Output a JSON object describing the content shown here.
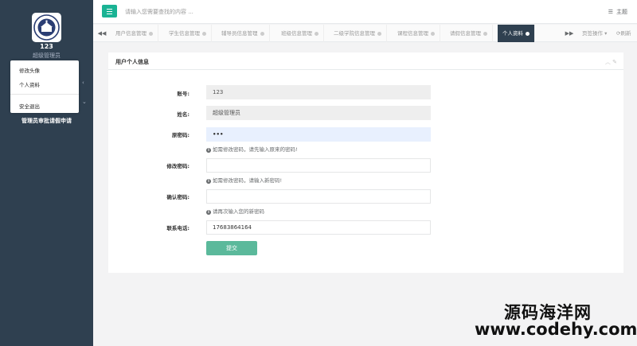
{
  "sidebar": {
    "user_name": "123",
    "user_role": "超级管理员",
    "dropdown_items": [
      "修改头像",
      "个人资料",
      "安全退出"
    ],
    "menu_item": "管理员审批请假申请"
  },
  "topbar": {
    "search_placeholder": "请输入您需要查找的内容 ...",
    "theme_label": "主题"
  },
  "tabs": {
    "items": [
      {
        "label": "用户信息管理"
      },
      {
        "label": "学生信息管理"
      },
      {
        "label": "辅导员信息管理"
      },
      {
        "label": "班级信息管理"
      },
      {
        "label": "二级学院信息管理"
      },
      {
        "label": "课程信息管理"
      },
      {
        "label": "请假信息管理"
      },
      {
        "label": "个人资料",
        "active": true
      }
    ],
    "page_ops": "页签操作",
    "refresh": "刷新"
  },
  "panel": {
    "title": "用户个人信息",
    "fields": {
      "account_label": "账号:",
      "account_value": "123",
      "name_label": "姓名:",
      "name_value": "超级管理员",
      "old_pwd_label": "原密码:",
      "old_pwd_value": "•••",
      "old_pwd_hint": "如需修改密码，请先输入原来的密码!",
      "new_pwd_label": "修改密码:",
      "new_pwd_hint": "如需修改密码，请输入新密码!",
      "confirm_pwd_label": "确认密码:",
      "confirm_pwd_hint": "请再次输入您的新密码",
      "phone_label": "联系电话:",
      "phone_value": "17683864164"
    },
    "submit_label": "提交"
  },
  "watermark": {
    "line1": "源码海洋网",
    "line2": "www.codehy.com"
  },
  "colors": {
    "sidebar": "#2f4050",
    "accent": "#1ab394",
    "submit": "#5bb99b"
  }
}
